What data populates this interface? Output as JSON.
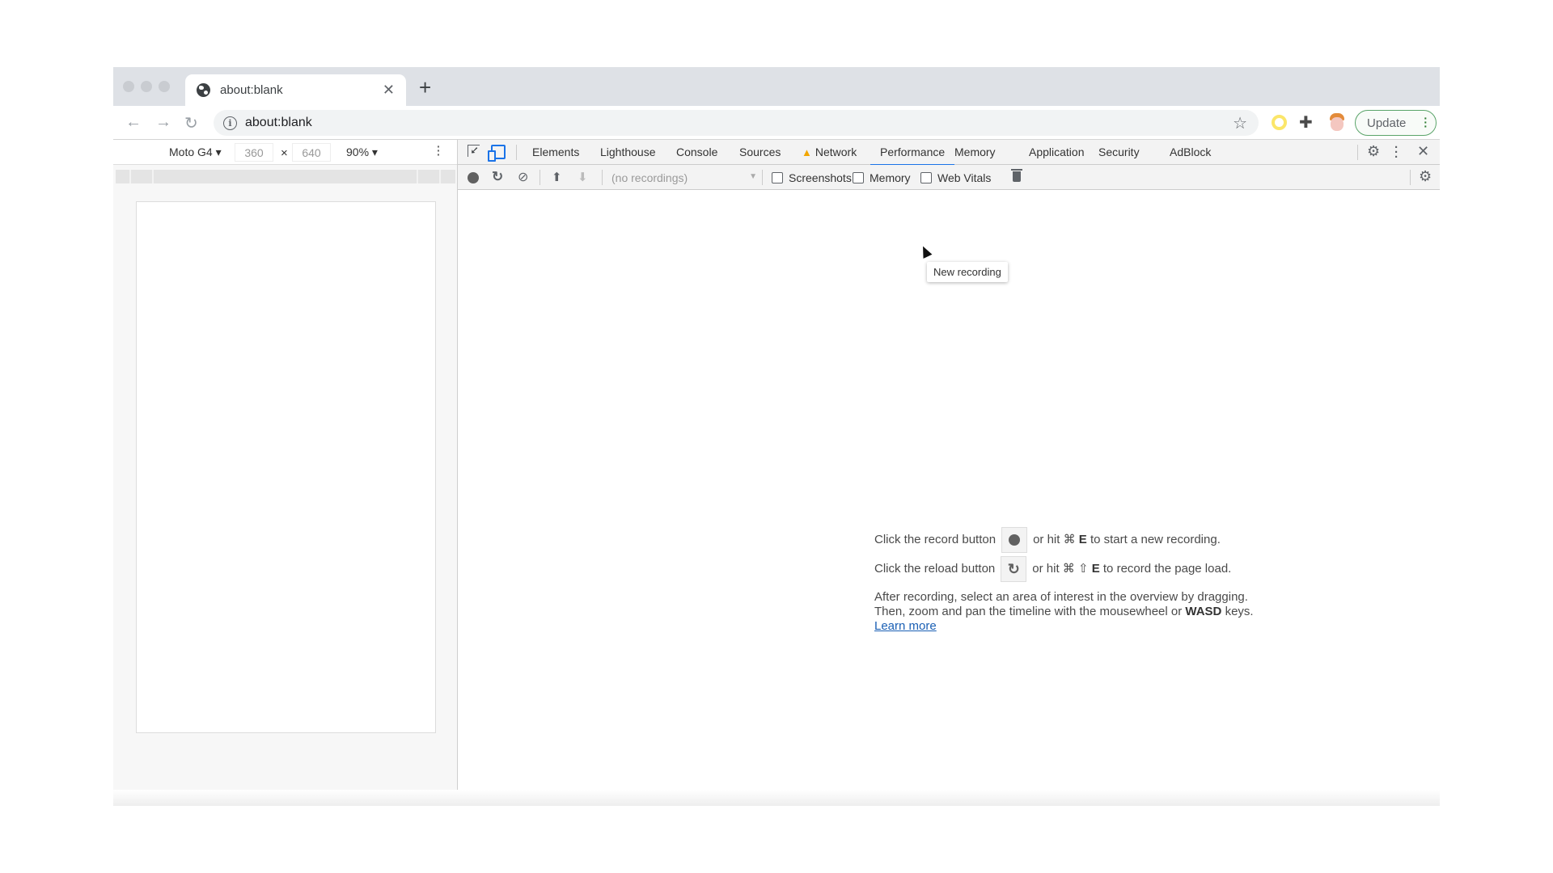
{
  "browser": {
    "tab": {
      "title": "about:blank"
    },
    "new_tab_label": "+",
    "address": {
      "url": "about:blank"
    },
    "update_label": "Update"
  },
  "device_toolbar": {
    "device": "Moto G4",
    "width": "360",
    "height": "640",
    "times": "×",
    "zoom": "90%"
  },
  "devtools": {
    "tabs": [
      {
        "label": "Elements"
      },
      {
        "label": "Lighthouse"
      },
      {
        "label": "Console"
      },
      {
        "label": "Sources"
      },
      {
        "label": "Network",
        "warning": true
      },
      {
        "label": "Performance",
        "active": true
      },
      {
        "label": "Memory"
      },
      {
        "label": "Application"
      },
      {
        "label": "Security"
      },
      {
        "label": "AdBlock"
      }
    ],
    "performance_toolbar": {
      "recordings_placeholder": "(no recordings)",
      "checkboxes": [
        {
          "label": "Screenshots",
          "checked": false
        },
        {
          "label": "Memory",
          "checked": false
        },
        {
          "label": "Web Vitals",
          "checked": false
        }
      ]
    },
    "tooltip": "New recording",
    "landing": {
      "record_pre": "Click the record button",
      "record_post_a": "or hit ⌘",
      "record_key": "E",
      "record_post_b": "to start a new recording.",
      "reload_pre": "Click the reload button",
      "reload_post_a": "or hit ⌘ ⇧",
      "reload_key": "E",
      "reload_post_b": "to record the page load.",
      "para_line1": "After recording, select an area of interest in the overview by dragging.",
      "para_line2_a": "Then, zoom and pan the timeline with the mousewheel or",
      "para_line2_key": "WASD",
      "para_line2_b": "keys.",
      "learn_more": "Learn more"
    }
  }
}
